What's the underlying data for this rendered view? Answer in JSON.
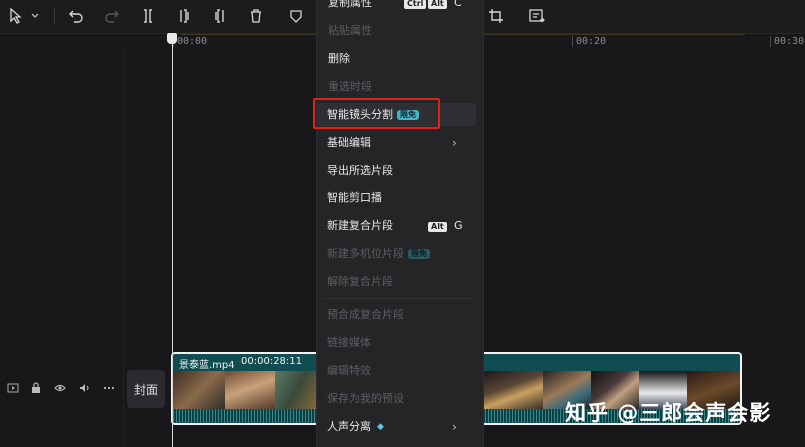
{
  "toolbar": {
    "icons": [
      "select-arrow-icon",
      "dropdown-chevron-icon",
      "undo-icon",
      "redo-icon",
      "split-icon",
      "split-left-icon",
      "split-right-icon",
      "delete-icon",
      "shield-icon",
      "crop-icon",
      "export-frame-icon"
    ]
  },
  "ruler": {
    "ticks": [
      "00:00",
      "00:20",
      "00:30"
    ]
  },
  "track": {
    "cover_label": "封面"
  },
  "clip": {
    "name": "景泰蓝.mp4",
    "duration": "00:00:28:11"
  },
  "context_menu": {
    "items": [
      {
        "label": "复制属性",
        "enabled": true,
        "kbd": "Ctrl",
        "kbd2": "Alt",
        "key": "C"
      },
      {
        "label": "粘贴属性",
        "enabled": false
      },
      {
        "label": "删除",
        "enabled": true
      },
      {
        "label": "重选时段",
        "enabled": false
      },
      {
        "label": "智能镜头分割",
        "enabled": true,
        "badge": "限免",
        "highlighted": true
      },
      {
        "label": "基础编辑",
        "enabled": true,
        "submenu": true
      },
      {
        "label": "导出所选片段",
        "enabled": true
      },
      {
        "label": "智能剪口播",
        "enabled": true
      },
      {
        "label": "新建复合片段",
        "enabled": true,
        "kbd": "Alt",
        "key": "G"
      },
      {
        "label": "新建多机位片段",
        "enabled": false,
        "badge": "限免"
      },
      {
        "label": "解除复合片段",
        "enabled": false
      },
      {
        "label": "预合成复合片段",
        "enabled": false
      },
      {
        "label": "链接媒体",
        "enabled": false
      },
      {
        "label": "编辑特效",
        "enabled": false
      },
      {
        "label": "保存为我的预设",
        "enabled": false
      },
      {
        "label": "人声分离",
        "enabled": true,
        "submenu": true,
        "icon": "diamond-icon"
      }
    ]
  },
  "watermark": "知乎 @三郎会声会影"
}
